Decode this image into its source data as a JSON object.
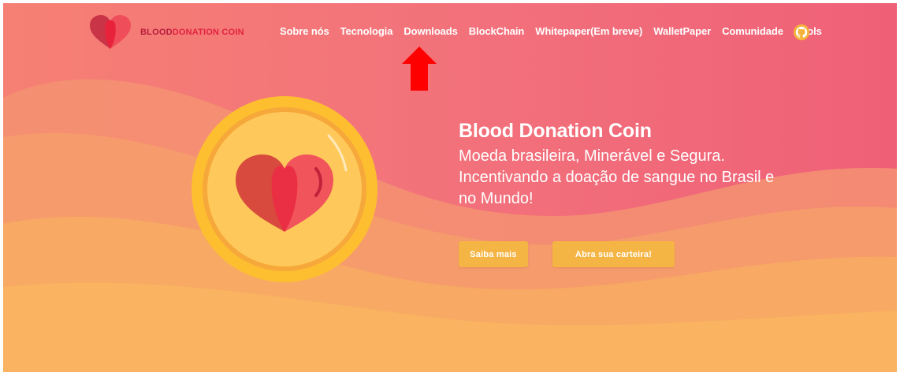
{
  "brand": {
    "name_part1": "BLOOD",
    "name_part2": "DONATION COIN",
    "logo_icon": "heart-coin-icon"
  },
  "nav": {
    "items": [
      {
        "label": "Sobre nós"
      },
      {
        "label": "Tecnologia"
      },
      {
        "label": "Downloads"
      },
      {
        "label": "BlockChain"
      },
      {
        "label": "Whitepaper(Em breve)"
      },
      {
        "label": "WalletPaper"
      },
      {
        "label": "Comunidade"
      },
      {
        "label": "Pools"
      }
    ],
    "github_icon": "github-icon"
  },
  "annotation": {
    "icon": "red-up-arrow-icon",
    "points_to": "Downloads"
  },
  "hero": {
    "title": "Blood Donation Coin",
    "subtitle": "Moeda brasileira, Minerável e Segura. Incentivando a doação de sangue no Brasil e no Mundo!",
    "coin_icon": "heart-coin-icon",
    "buttons": {
      "primary": "Saiba mais",
      "secondary": "Abra sua carteira!"
    }
  },
  "colors": {
    "background_pink": "#f2707b",
    "wave_orange": "#f8ad62",
    "button_yellow": "#f5b544",
    "coin_gold": "#fbb52a",
    "heart_red": "#ef3f4c",
    "brand_dark_red": "#b71c3b",
    "annotation_arrow": "#ff0000"
  }
}
